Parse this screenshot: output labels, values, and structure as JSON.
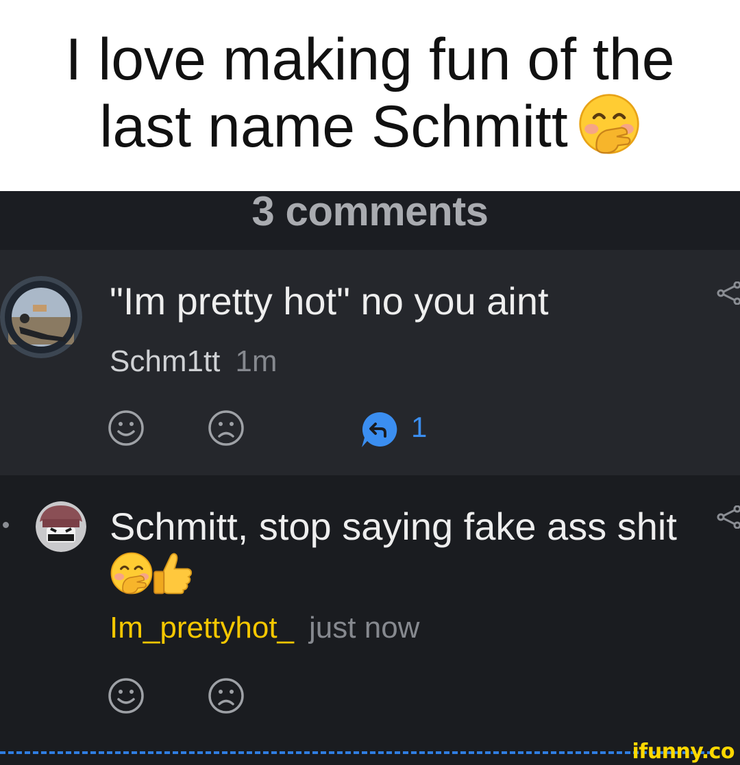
{
  "caption": {
    "text": "I love making fun of the last name Schmitt",
    "emoji_icon": "hand-over-mouth-emoji"
  },
  "header": {
    "comments_label": "3 comments"
  },
  "comments": [
    {
      "text": "\"Im pretty hot\" no you aint",
      "author": "Schm1tt",
      "time": "1m",
      "author_color": "#cfd1d4",
      "reply_count": "1",
      "avatar_icon": "avatar-photo"
    },
    {
      "text": "Schmitt, stop saying fake ass shit",
      "emojis": [
        "hand-over-mouth-emoji",
        "thumbs-up-emoji"
      ],
      "author": "Im_prettyhot_",
      "time": "just now",
      "author_color": "#f6c700",
      "avatar_icon": "avatar-cartoon"
    }
  ],
  "watermark": "ifunny.co",
  "colors": {
    "accent_blue": "#3b8ef0",
    "highlight_author": "#f6c700",
    "background": "#1a1c20",
    "card_background": "#25272c"
  }
}
